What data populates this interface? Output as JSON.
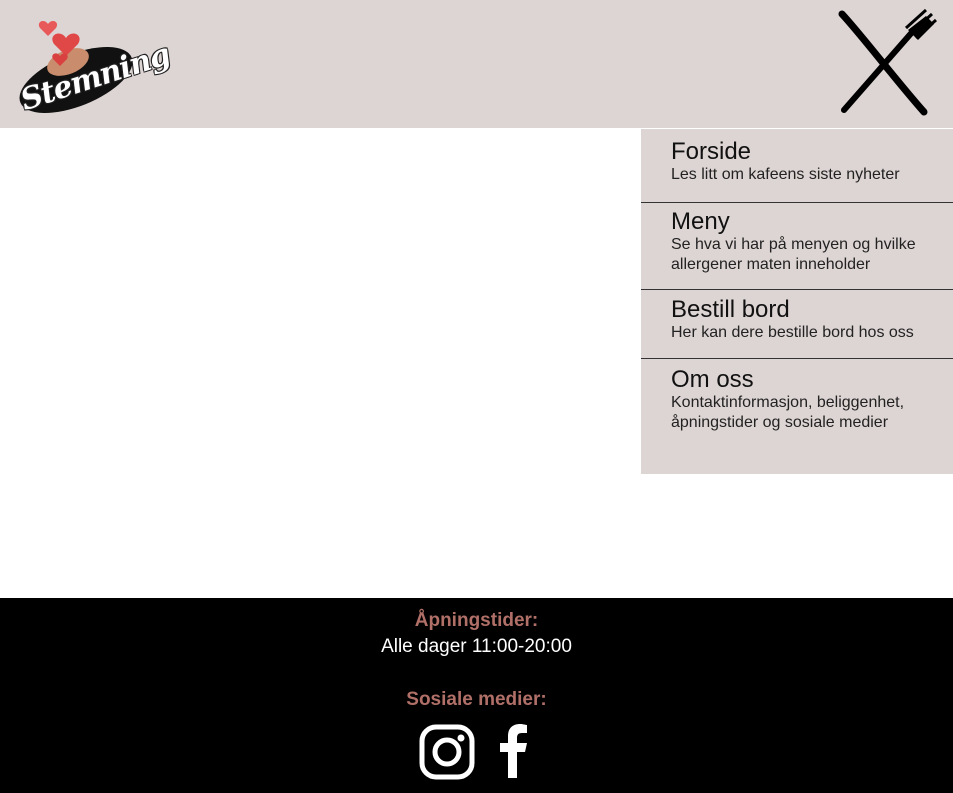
{
  "header": {
    "logo_text": "Stemning",
    "close_icon": "close-x-fork-icon"
  },
  "menu": {
    "items": [
      {
        "title": "Forside",
        "desc": "Les litt om kafeens siste nyheter"
      },
      {
        "title": "Meny",
        "desc": "Se hva vi har på menyen og hvilke allergener maten inneholder"
      },
      {
        "title": "Bestill bord",
        "desc": "Her kan dere bestille bord hos oss"
      },
      {
        "title": "Om oss",
        "desc": "Kontaktinformasjon, beliggenhet, åpningstider og sosiale medier"
      }
    ]
  },
  "footer": {
    "hours_label": "Åpningstider:",
    "hours_value": "Alle dager 11:00-20:00",
    "social_label": "Sosiale medier:",
    "social_icons": [
      "instagram-icon",
      "facebook-icon"
    ]
  },
  "colors": {
    "header_bg": "#ddd5d3",
    "footer_bg": "#000000",
    "accent": "#b07068"
  }
}
